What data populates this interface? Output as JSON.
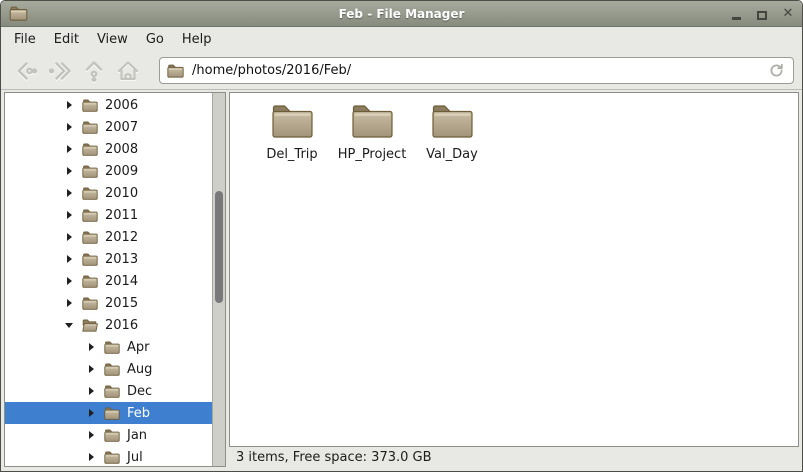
{
  "window": {
    "title": "Feb - File Manager",
    "controls": {
      "minimize": "minimize",
      "maximize": "maximize",
      "close": "close"
    }
  },
  "menubar": {
    "items": [
      "File",
      "Edit",
      "View",
      "Go",
      "Help"
    ]
  },
  "toolbar": {
    "path": "/home/photos/2016/Feb/",
    "buttons": [
      "back",
      "forward",
      "up",
      "home",
      "reload"
    ]
  },
  "sidebar": {
    "tree": [
      {
        "label": "2006",
        "level": 0,
        "expanded": false,
        "selected": false
      },
      {
        "label": "2007",
        "level": 0,
        "expanded": false,
        "selected": false
      },
      {
        "label": "2008",
        "level": 0,
        "expanded": false,
        "selected": false
      },
      {
        "label": "2009",
        "level": 0,
        "expanded": false,
        "selected": false
      },
      {
        "label": "2010",
        "level": 0,
        "expanded": false,
        "selected": false
      },
      {
        "label": "2011",
        "level": 0,
        "expanded": false,
        "selected": false
      },
      {
        "label": "2012",
        "level": 0,
        "expanded": false,
        "selected": false
      },
      {
        "label": "2013",
        "level": 0,
        "expanded": false,
        "selected": false
      },
      {
        "label": "2014",
        "level": 0,
        "expanded": false,
        "selected": false
      },
      {
        "label": "2015",
        "level": 0,
        "expanded": false,
        "selected": false
      },
      {
        "label": "2016",
        "level": 0,
        "expanded": true,
        "selected": false
      },
      {
        "label": "Apr",
        "level": 1,
        "expanded": false,
        "selected": false
      },
      {
        "label": "Aug",
        "level": 1,
        "expanded": false,
        "selected": false
      },
      {
        "label": "Dec",
        "level": 1,
        "expanded": false,
        "selected": false
      },
      {
        "label": "Feb",
        "level": 1,
        "expanded": false,
        "selected": true
      },
      {
        "label": "Jan",
        "level": 1,
        "expanded": false,
        "selected": false
      },
      {
        "label": "Jul",
        "level": 1,
        "expanded": false,
        "selected": false
      }
    ]
  },
  "main": {
    "folders": [
      {
        "name": "Del_Trip"
      },
      {
        "name": "HP_Project"
      },
      {
        "name": "Val_Day"
      }
    ]
  },
  "statusbar": {
    "text": "3 items, Free space: 373.0 GB"
  },
  "icons": {
    "app": "folder-icon",
    "nav": [
      "back-arrow-icon",
      "forward-arrow-icon",
      "up-arrow-icon",
      "home-icon"
    ],
    "pathbar": "folder-icon",
    "reload": "reload-icon",
    "tree_collapsed": "triangle-right-icon",
    "tree_expanded": "triangle-down-icon"
  },
  "colors": {
    "selection_blue": "#3e7fd0",
    "titlebar_top": "#a6ab9e",
    "titlebar_bottom": "#868b7e",
    "chrome_bg": "#e8e8e4",
    "folder_body": "#b9ab8f",
    "folder_tab": "#8d7d5f",
    "folder_outline": "#6e5d3a"
  }
}
